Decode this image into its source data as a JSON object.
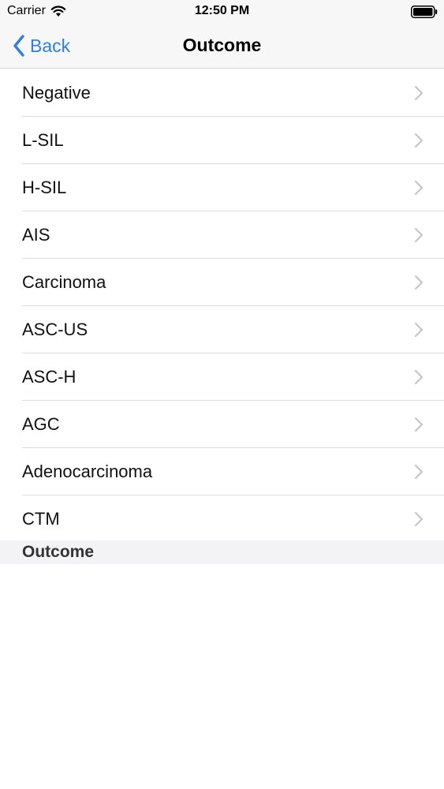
{
  "status_bar": {
    "carrier": "Carrier",
    "time": "12:50 PM",
    "icons": [
      "wifi-icon",
      "battery-icon"
    ]
  },
  "nav_bar": {
    "back_label": "Back",
    "title": "Outcome",
    "back_icon": "chevron-left-icon",
    "accent_color": "#2d7fe0"
  },
  "list": {
    "items": [
      {
        "label": "Negative"
      },
      {
        "label": "L-SIL"
      },
      {
        "label": "H-SIL"
      },
      {
        "label": "AIS"
      },
      {
        "label": "Carcinoma"
      },
      {
        "label": "ASC-US"
      },
      {
        "label": "ASC-H"
      },
      {
        "label": "AGC"
      },
      {
        "label": "Adenocarcinoma"
      },
      {
        "label": "CTM"
      }
    ],
    "disclosure_icon": "chevron-right-icon"
  },
  "section_footer": {
    "label": "Outcome"
  }
}
